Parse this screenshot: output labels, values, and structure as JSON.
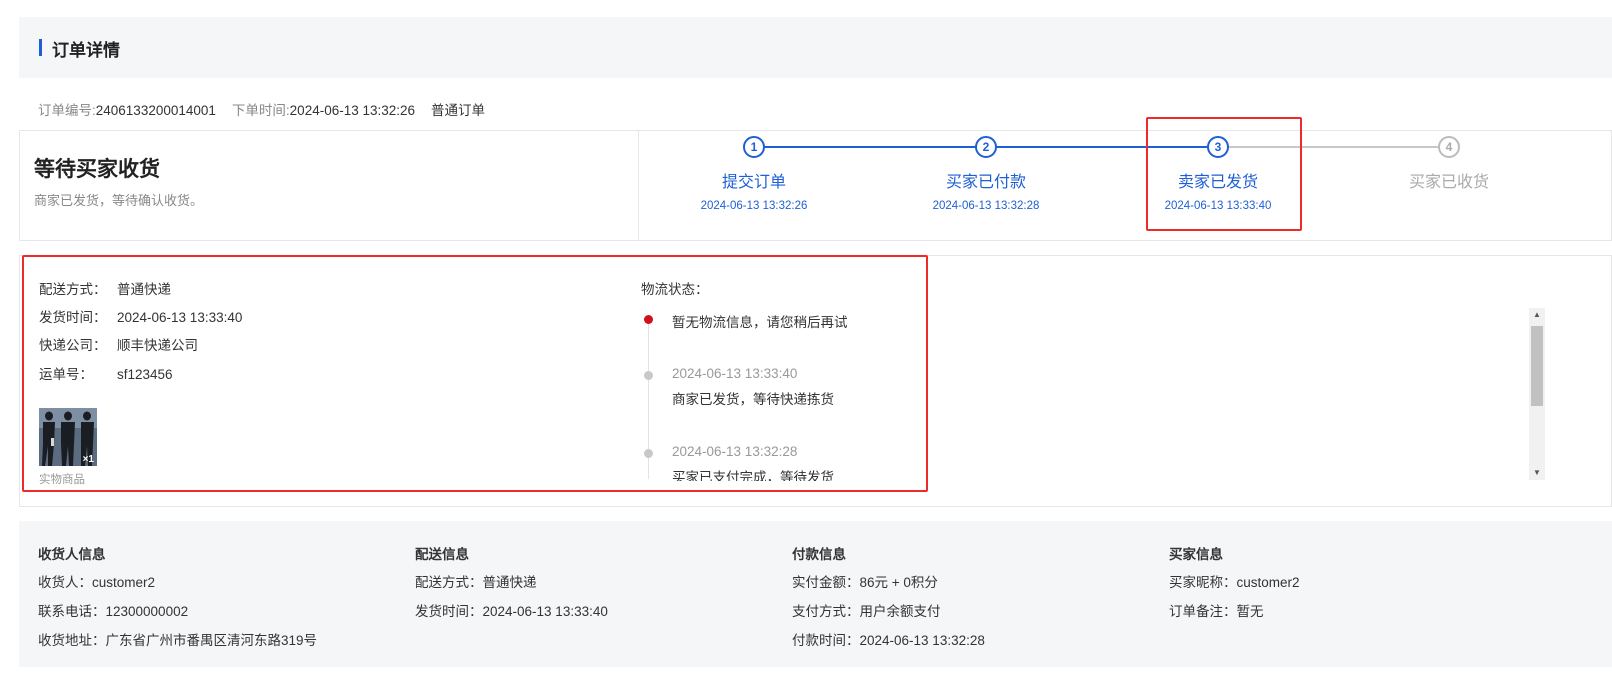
{
  "header": {
    "title": "订单详情"
  },
  "meta": {
    "order_no_label": "订单编号:",
    "order_no": "2406133200014001",
    "order_time_label": "下单时间:",
    "order_time": "2024-06-13 13:32:26",
    "order_type": "普通订单"
  },
  "status": {
    "title": "等待买家收货",
    "desc": "商家已发货，等待确认收货。"
  },
  "steps": [
    {
      "num": "1",
      "label": "提交订单",
      "time": "2024-06-13 13:32:26"
    },
    {
      "num": "2",
      "label": "买家已付款",
      "time": "2024-06-13 13:32:28"
    },
    {
      "num": "3",
      "label": "卖家已发货",
      "time": "2024-06-13 13:33:40"
    },
    {
      "num": "4",
      "label": "买家已收货",
      "time": ""
    }
  ],
  "shipping": {
    "rows": [
      {
        "k": "配送方式：",
        "v": "普通快递"
      },
      {
        "k": "发货时间：",
        "v": "2024-06-13 13:33:40"
      },
      {
        "k": "快递公司：",
        "v": "顺丰快递公司"
      },
      {
        "k": "运单号：",
        "v": "sf123456"
      }
    ],
    "product_qty": "×1",
    "product_caption": "实物商品"
  },
  "logistics": {
    "title": "物流状态：",
    "current": "暂无物流信息，请您稍后再试",
    "events": [
      {
        "time": "2024-06-13 13:33:40",
        "text": "商家已发货，等待快递拣货"
      },
      {
        "time": "2024-06-13 13:32:28",
        "text": "买家已支付完成，等待发货"
      }
    ]
  },
  "info": {
    "receiver": {
      "title": "收货人信息",
      "lines": [
        "收货人：customer2",
        "联系电话：12300000002",
        "收货地址：广东省广州市番禺区清河东路319号"
      ]
    },
    "delivery": {
      "title": "配送信息",
      "lines": [
        "配送方式：普通快递",
        "发货时间：2024-06-13 13:33:40"
      ]
    },
    "payment": {
      "title": "付款信息",
      "lines": [
        "实付金额：86元 + 0积分",
        "支付方式：用户余额支付",
        "付款时间：2024-06-13 13:32:28"
      ]
    },
    "buyer": {
      "title": "买家信息",
      "lines": [
        "买家昵称：customer2",
        "订单备注：暂无"
      ]
    }
  },
  "colors": {
    "accent": "#1f5fd6",
    "highlight": "#ee2b2b",
    "log_dot_current": "#d0101b"
  }
}
